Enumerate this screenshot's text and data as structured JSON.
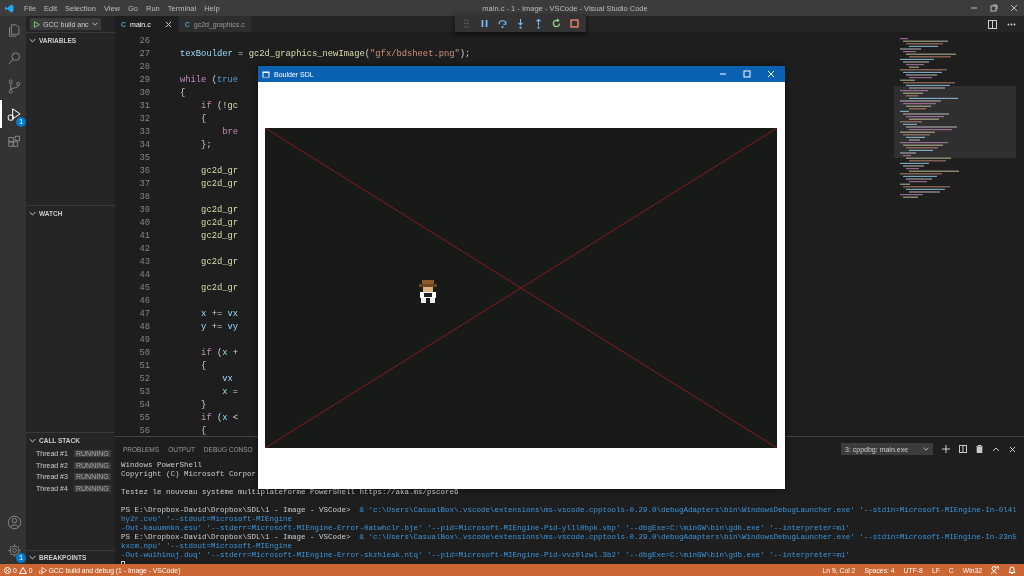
{
  "title_bar": {
    "menu": [
      "File",
      "Edit",
      "Selection",
      "View",
      "Go",
      "Run",
      "Terminal",
      "Help"
    ],
    "title": "main.c - 1 - Image - VSCode - Visual Studio Code"
  },
  "activity_bar": {
    "items": [
      {
        "kind": "files",
        "selected": false
      },
      {
        "kind": "search",
        "selected": false
      },
      {
        "kind": "source-control",
        "selected": false
      },
      {
        "kind": "debug",
        "selected": true,
        "badge": "1"
      },
      {
        "kind": "extensions",
        "selected": false
      }
    ],
    "bottom": [
      {
        "kind": "account"
      },
      {
        "kind": "settings",
        "badge": "1"
      }
    ]
  },
  "debug_toolbar": {
    "buttons": [
      {
        "kind": "grip"
      },
      {
        "kind": "pause"
      },
      {
        "kind": "step-over"
      },
      {
        "kind": "step-into"
      },
      {
        "kind": "step-out"
      },
      {
        "kind": "restart"
      },
      {
        "kind": "stop"
      }
    ]
  },
  "sidebar": {
    "launch_config": "GCC build anc",
    "sections": [
      {
        "title": "VARIABLES",
        "expanded": true
      },
      {
        "title": "WATCH",
        "expanded": true
      },
      {
        "title": "CALL STACK",
        "expanded": true,
        "threads": [
          {
            "name": "Thread #1",
            "status": "RUNNING"
          },
          {
            "name": "Thread #2",
            "status": "RUNNING"
          },
          {
            "name": "Thread #3",
            "status": "RUNNING"
          },
          {
            "name": "Thread #4",
            "status": "RUNNING"
          }
        ]
      },
      {
        "title": "BREAKPOINTS",
        "expanded": true
      }
    ]
  },
  "editor": {
    "tabs": [
      {
        "icon": "C",
        "label": "main.c",
        "selected": true
      },
      {
        "icon": "C",
        "label": "gc2d_graphics.c",
        "selected": false
      }
    ],
    "lines": [
      {
        "number": "26"
      },
      {
        "number": "27",
        "tokens": [
          {
            "kind": "variable",
            "text": "texBoulder"
          },
          {
            "kind": "plain",
            "text": " = "
          },
          {
            "kind": "function",
            "text": "gc2d_graphics_newImage"
          },
          {
            "kind": "plain",
            "text": "("
          },
          {
            "kind": "string",
            "text": "\"gfx/bdsheet.png\""
          },
          {
            "kind": "plain",
            "text": ");"
          }
        ]
      },
      {
        "number": "28"
      },
      {
        "number": "29",
        "tokens": [
          {
            "kind": "control",
            "text": "while"
          },
          {
            "kind": "plain",
            "text": " ("
          },
          {
            "kind": "constant",
            "text": "true"
          }
        ]
      },
      {
        "number": "30",
        "tokens": [
          {
            "kind": "plain",
            "text": "{"
          }
        ]
      },
      {
        "number": "31",
        "tokens": [
          {
            "kind": "control",
            "text": "    if"
          },
          {
            "kind": "plain",
            "text": " (!"
          },
          {
            "kind": "function",
            "text": "gc"
          }
        ]
      },
      {
        "number": "32",
        "tokens": [
          {
            "kind": "plain",
            "text": "    {"
          }
        ]
      },
      {
        "number": "33",
        "tokens": [
          {
            "kind": "control",
            "text": "        bre"
          }
        ]
      },
      {
        "number": "34",
        "tokens": [
          {
            "kind": "plain",
            "text": "    };"
          }
        ]
      },
      {
        "number": "35"
      },
      {
        "number": "36",
        "tokens": [
          {
            "kind": "function",
            "text": "    gc2d_gr"
          }
        ]
      },
      {
        "number": "37",
        "tokens": [
          {
            "kind": "function",
            "text": "    gc2d_gr"
          }
        ]
      },
      {
        "number": "38"
      },
      {
        "number": "39",
        "tokens": [
          {
            "kind": "function",
            "text": "    gc2d_gr"
          }
        ]
      },
      {
        "number": "40",
        "tokens": [
          {
            "kind": "function",
            "text": "    gc2d_gr"
          }
        ]
      },
      {
        "number": "41",
        "tokens": [
          {
            "kind": "function",
            "text": "    gc2d_gr"
          }
        ]
      },
      {
        "number": "42"
      },
      {
        "number": "43",
        "tokens": [
          {
            "kind": "function",
            "text": "    gc2d_gr"
          }
        ]
      },
      {
        "number": "44"
      },
      {
        "number": "45",
        "tokens": [
          {
            "kind": "function",
            "text": "    gc2d_gr"
          }
        ]
      },
      {
        "number": "46"
      },
      {
        "number": "47",
        "tokens": [
          {
            "kind": "variable",
            "text": "    x"
          },
          {
            "kind": "plain",
            "text": " += "
          },
          {
            "kind": "variable",
            "text": "vx"
          }
        ]
      },
      {
        "number": "48",
        "tokens": [
          {
            "kind": "variable",
            "text": "    y"
          },
          {
            "kind": "plain",
            "text": " += "
          },
          {
            "kind": "variable",
            "text": "vy"
          }
        ]
      },
      {
        "number": "49"
      },
      {
        "number": "50",
        "tokens": [
          {
            "kind": "control",
            "text": "    if"
          },
          {
            "kind": "plain",
            "text": " ("
          },
          {
            "kind": "variable",
            "text": "x"
          },
          {
            "kind": "plain",
            "text": " +"
          }
        ]
      },
      {
        "number": "51",
        "tokens": [
          {
            "kind": "plain",
            "text": "    {"
          }
        ]
      },
      {
        "number": "52",
        "tokens": [
          {
            "kind": "variable",
            "text": "        vx"
          }
        ]
      },
      {
        "number": "53",
        "tokens": [
          {
            "kind": "variable",
            "text": "        x"
          },
          {
            "kind": "plain",
            "text": " ="
          }
        ]
      },
      {
        "number": "54",
        "tokens": [
          {
            "kind": "plain",
            "text": "    }"
          }
        ]
      },
      {
        "number": "55",
        "tokens": [
          {
            "kind": "control",
            "text": "    if"
          },
          {
            "kind": "plain",
            "text": " ("
          },
          {
            "kind": "variable",
            "text": "x"
          },
          {
            "kind": "plain",
            "text": " <"
          }
        ]
      },
      {
        "number": "56",
        "tokens": [
          {
            "kind": "plain",
            "text": "    {"
          }
        ]
      }
    ]
  },
  "panel": {
    "tabs": [
      {
        "label": "PROBLEMS",
        "selected": false
      },
      {
        "label": "OUTPUT",
        "selected": false
      },
      {
        "label": "DEBUG CONSO",
        "selected": false
      }
    ],
    "terminal_select": "3: cppdbg: main.exe",
    "lines": [
      {
        "kind": "text",
        "text": "Windows PowerShell"
      },
      {
        "kind": "text",
        "text": "Copyright (C) Microsoft Corpor"
      },
      {
        "kind": "blank"
      },
      {
        "kind": "text",
        "text": "Testez le nouveau système multiplateforme PowerShell https://aka.ms/pscore6"
      },
      {
        "kind": "blank"
      },
      {
        "kind": "command",
        "prompt": "PS E:\\Dropbox-David\\Dropbox\\SDL\\1 - Image - VSCode>",
        "text": "  & 'c:\\Users\\CasualBox\\.vscode\\extensions\\ms-vscode.cpptools-0.29.0\\debugAdapters\\bin\\WindowsDebugLauncher.exe' '--stdin=Microsoft-MIEngine-In-0l4lhy2r.cvo' '--stdout=Microsoft-MIEngine"
      },
      {
        "kind": "continuation",
        "text": "-Out-kauumnkn.esu' '--stderr=Microsoft-MIEngine-Error-0atwhclr.bje' '--pid=Microsoft-MIEngine-Pid-ylll0bpk.vbp' '--dbgExe=C:\\minGW\\bin\\gdb.exe' '--interpreter=mi'"
      },
      {
        "kind": "command",
        "prompt": "PS E:\\Dropbox-David\\Dropbox\\SDL\\1 - Image - VSCode>",
        "text": "  & 'c:\\Users\\CasualBox\\.vscode\\extensions\\ms-vscode.cpptools-0.29.0\\debugAdapters\\bin\\WindowsDebugLauncher.exe' '--stdin=Microsoft-MIEngine-In-23n5kxcm.npu' '--stdout=Microsoft-MIEngine"
      },
      {
        "kind": "continuation",
        "text": "-Out-wuihinuj.duq' '--stderr=Microsoft-MIEngine-Error-skzh1eak.ntq' '--pid=Microsoft-MIEngine-Pid-vvz0lzwl.3b2' '--dbgExe=C:\\minGW\\bin\\gdb.exe' '--interpreter=mi'"
      },
      {
        "kind": "cursor"
      }
    ]
  },
  "app_window": {
    "title": "Boulder SDL"
  },
  "status_bar": {
    "errors": "0",
    "warnings": "0",
    "debug_target": "GCC build and debug (1 - Image - VSCode)",
    "items": [
      "Ln 9, Col 2",
      "Spaces: 4",
      "UTF-8",
      "LF",
      "C",
      "Win32"
    ]
  }
}
